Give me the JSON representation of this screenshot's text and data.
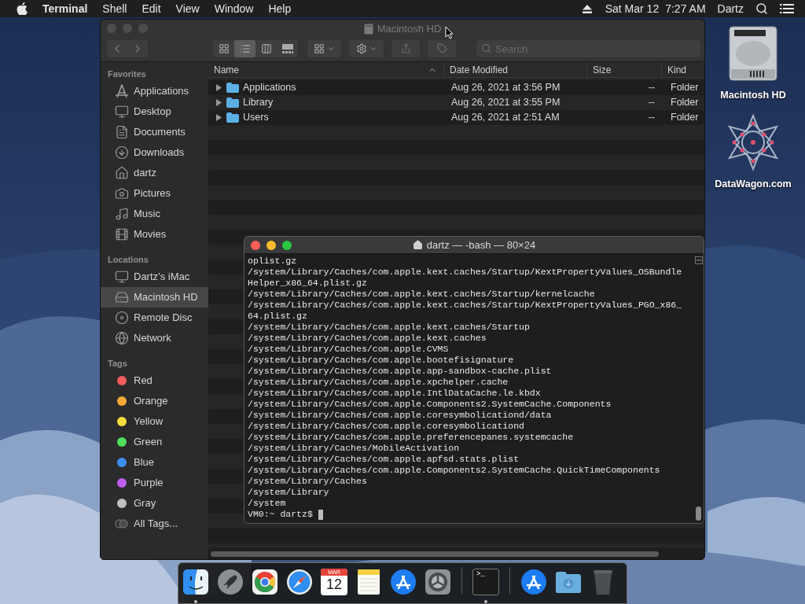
{
  "menu_bar": {
    "app_name": "Terminal",
    "menus": [
      "Shell",
      "Edit",
      "View",
      "Window",
      "Help"
    ],
    "date": "Sat Mar 12",
    "time": "7:27 AM",
    "user": "Dartz"
  },
  "finder": {
    "title": "Macintosh HD",
    "active": false,
    "view_buttons": [
      {
        "selected": false
      },
      {
        "selected": true
      },
      {
        "selected": false
      },
      {
        "selected": false
      }
    ],
    "search": {
      "placeholder": "Search"
    },
    "sidebar": [
      {
        "heading": "Favorites",
        "items": [
          {
            "kind": "place",
            "label": "Applications",
            "selected": false
          },
          {
            "kind": "place",
            "label": "Desktop",
            "selected": false
          },
          {
            "kind": "place",
            "label": "Documents",
            "selected": false
          },
          {
            "kind": "place",
            "label": "Downloads",
            "selected": false
          },
          {
            "kind": "place",
            "label": "dartz",
            "selected": false
          },
          {
            "kind": "place",
            "label": "Pictures",
            "selected": false
          },
          {
            "kind": "place",
            "label": "Music",
            "selected": false
          },
          {
            "kind": "place",
            "label": "Movies",
            "selected": false
          }
        ]
      },
      {
        "heading": "Locations",
        "items": [
          {
            "kind": "place",
            "label": "Dartz’s iMac",
            "selected": false
          },
          {
            "kind": "place",
            "label": "Macintosh HD",
            "selected": true
          },
          {
            "kind": "place",
            "label": "Remote Disc",
            "selected": false
          },
          {
            "kind": "place",
            "label": "Network",
            "selected": false
          }
        ]
      },
      {
        "heading": "Tags",
        "items": [
          {
            "kind": "tag",
            "label": "Red",
            "color": "#f25c5c",
            "selected": false
          },
          {
            "kind": "tag",
            "label": "Orange",
            "color": "#f7a935",
            "selected": false
          },
          {
            "kind": "tag",
            "label": "Yellow",
            "color": "#f5de3a",
            "selected": false
          },
          {
            "kind": "tag",
            "label": "Green",
            "color": "#4ee05a",
            "selected": false
          },
          {
            "kind": "tag",
            "label": "Blue",
            "color": "#3d8ef0",
            "selected": false
          },
          {
            "kind": "tag",
            "label": "Purple",
            "color": "#c15ef0",
            "selected": false
          },
          {
            "kind": "tag",
            "label": "Gray",
            "color": "#c0c0c0",
            "selected": false
          },
          {
            "kind": "all_tags",
            "label": "All Tags...",
            "selected": false
          }
        ]
      }
    ],
    "columns": [
      {
        "label": "Name",
        "sorted": true
      },
      {
        "label": "Date Modified",
        "sorted": false
      },
      {
        "label": "Size",
        "sorted": false
      },
      {
        "label": "Kind",
        "sorted": false
      }
    ],
    "rows": [
      {
        "name": "Applications",
        "date_modified": "Aug 26, 2021 at 3:56 PM",
        "size": "--",
        "file_kind": "Folder",
        "expanded": false
      },
      {
        "name": "Library",
        "date_modified": "Aug 26, 2021 at 3:55 PM",
        "size": "--",
        "file_kind": "Folder",
        "expanded": false
      },
      {
        "name": "Users",
        "date_modified": "Aug 26, 2021 at 2:51 AM",
        "size": "--",
        "file_kind": "Folder",
        "expanded": false
      }
    ]
  },
  "terminal": {
    "title": "dartz — -bash — 80×24",
    "active": true,
    "lines": [
      "oplist.gz",
      "/system/Library/Caches/com.apple.kext.caches/Startup/KextPropertyValues_OSBundle",
      "Helper_x86_64.plist.gz",
      "/system/Library/Caches/com.apple.kext.caches/Startup/kernelcache",
      "/system/Library/Caches/com.apple.kext.caches/Startup/KextPropertyValues_PGO_x86_",
      "64.plist.gz",
      "/system/Library/Caches/com.apple.kext.caches/Startup",
      "/system/Library/Caches/com.apple.kext.caches",
      "/system/Library/Caches/com.apple.CVMS",
      "/system/Library/Caches/com.apple.bootefisignature",
      "/system/Library/Caches/com.apple.app-sandbox-cache.plist",
      "/system/Library/Caches/com.apple.xpchelper.cache",
      "/system/Library/Caches/com.apple.IntlDataCache.le.kbdx",
      "/system/Library/Caches/com.apple.Components2.SystemCache.Components",
      "/system/Library/Caches/com.apple.coresymbolicationd/data",
      "/system/Library/Caches/com.apple.coresymbolicationd",
      "/system/Library/Caches/com.apple.preferencepanes.systemcache",
      "/system/Library/Caches/MobileActivation",
      "/system/Library/Caches/com.apple.apfsd.stats.plist",
      "/system/Library/Caches/com.apple.Components2.SystemCache.QuickTimeComponents",
      "/system/Library/Caches",
      "/system/Library",
      "/system"
    ],
    "prompt": "VM0:~ dartz$"
  },
  "desktop_icons": [
    {
      "label": "Macintosh HD"
    },
    {
      "label": "DataWagon.com"
    }
  ],
  "dock": {
    "items": [
      {
        "kind": "app",
        "running": true
      },
      {
        "kind": "app",
        "running": false
      },
      {
        "kind": "app",
        "running": false
      },
      {
        "kind": "app",
        "running": false
      },
      {
        "kind": "app",
        "running": false,
        "month": "MAR",
        "day": "12"
      },
      {
        "kind": "app",
        "running": false
      },
      {
        "kind": "app",
        "running": false
      },
      {
        "kind": "app",
        "running": false
      },
      {
        "kind": "separator"
      },
      {
        "kind": "app",
        "running": true,
        "glyph": ">_"
      },
      {
        "kind": "separator"
      },
      {
        "kind": "app",
        "running": false
      },
      {
        "kind": "app",
        "running": false
      },
      {
        "kind": "app",
        "running": false
      }
    ]
  }
}
